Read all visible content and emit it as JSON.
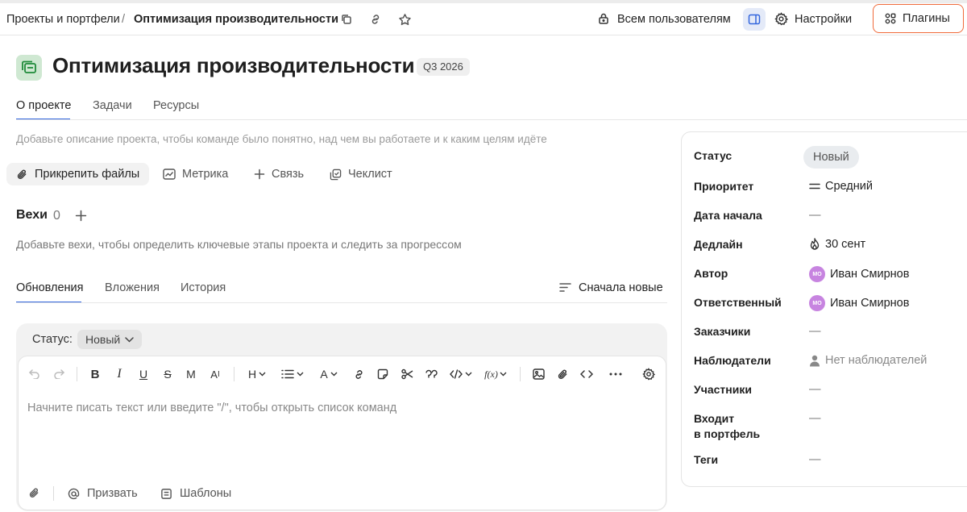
{
  "breadcrumb": {
    "parent": "Проекты и портфели",
    "separator": "/",
    "current": "Оптимизация производительности"
  },
  "topbar": {
    "visibility_label": "Всем пользователям",
    "settings_label": "Настройки",
    "plugins_label": "Плагины"
  },
  "project": {
    "title": "Оптимизация производительности",
    "badge": "Q3 2026"
  },
  "tabs": [
    "О проекте",
    "Задачи",
    "Ресурсы"
  ],
  "description_placeholder": "Добавьте описание проекта, чтобы команде было понятно, над чем вы работаете и к каким целям идёте",
  "actions": [
    "Прикрепить файлы",
    "Метрика",
    "Связь",
    "Чеклист"
  ],
  "milestones": {
    "title": "Вехи",
    "count": "0",
    "hint": "Добавьте вехи, чтобы определить ключевые этапы проекта и следить за прогрессом"
  },
  "updates": {
    "tabs": [
      "Обновления",
      "Вложения",
      "История"
    ],
    "sort_label": "Сначала новые",
    "status_label": "Статус:",
    "status_value": "Новый",
    "editor_placeholder": "Начните писать текст или введите \"/\", чтобы открыть список команд",
    "footer": [
      "Призвать",
      "Шаблоны"
    ]
  },
  "properties": {
    "status": {
      "label": "Статус",
      "value": "Новый"
    },
    "priority": {
      "label": "Приоритет",
      "value": "Средний"
    },
    "start_date": {
      "label": "Дата начала",
      "value": "—"
    },
    "deadline": {
      "label": "Дедлайн",
      "value": "30 сент"
    },
    "author": {
      "label": "Автор",
      "value": "Иван Смирнов",
      "initials": "MO"
    },
    "assignee": {
      "label": "Ответственный",
      "value": "Иван Смирнов",
      "initials": "MO"
    },
    "customers": {
      "label": "Заказчики",
      "value": "—"
    },
    "watchers": {
      "label": "Наблюдатели",
      "value": "Нет наблюдателей"
    },
    "members": {
      "label": "Участники",
      "value": "—"
    },
    "portfolio": {
      "label_line1": "Входит",
      "label_line2": "в портфель",
      "value": "—"
    },
    "tags": {
      "label": "Теги",
      "value": "—"
    }
  },
  "colors": {
    "accent": "#3366dd",
    "plugins_border": "#f06a3a",
    "avatar": "#c784e0",
    "project_icon_bg": "#cfe8d2",
    "project_icon_fg": "#1f8a3a"
  }
}
